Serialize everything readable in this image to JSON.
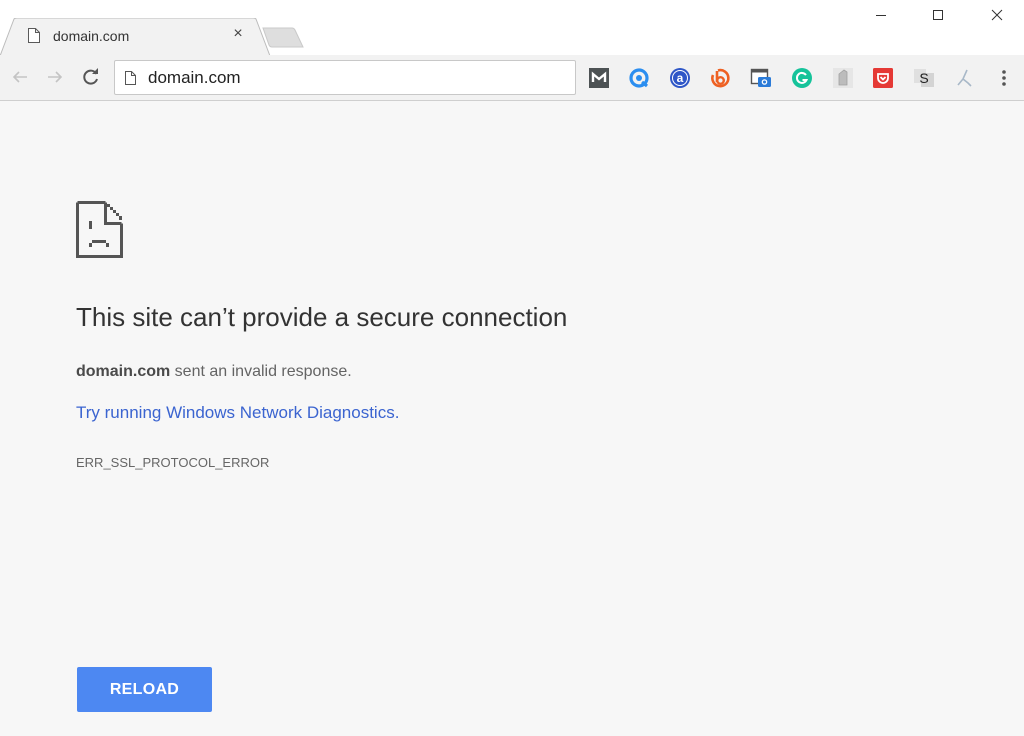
{
  "window": {
    "minimize_icon": "minimize-icon",
    "maximize_icon": "maximize-icon",
    "close_icon": "close-icon"
  },
  "tabs": [
    {
      "title": "domain.com",
      "icon": "page-icon",
      "close_glyph": "×",
      "active": true
    }
  ],
  "toolbar": {
    "back_icon": "arrow-left-icon",
    "forward_icon": "arrow-right-icon",
    "reload_icon": "reload-icon",
    "address": {
      "value": "domain.com",
      "icon": "page-icon"
    },
    "extensions": [
      {
        "name": "mailtrack",
        "glyph": "M",
        "color": "#4d5254"
      },
      {
        "name": "qeep",
        "glyph": "Q",
        "color": "#2b8ef0"
      },
      {
        "name": "amazon-assistant",
        "glyph": "a",
        "color": "#2e56c7"
      },
      {
        "name": "bitly",
        "glyph": "b",
        "color": "#ee6123"
      },
      {
        "name": "screenshot",
        "glyph": "",
        "color": "#2b7bd8"
      },
      {
        "name": "grammarly",
        "glyph": "G",
        "color": "#15c39a"
      },
      {
        "name": "evernote-clipper",
        "glyph": "",
        "color": "#bdbdbd"
      },
      {
        "name": "pocket",
        "glyph": "",
        "color": "#e53935"
      },
      {
        "name": "sumo",
        "glyph": "S",
        "color": "#cfcfcf"
      },
      {
        "name": "branch",
        "glyph": "",
        "color": "#9fb1c4"
      }
    ],
    "menu_icon": "more-vert-icon"
  },
  "error_page": {
    "icon": "sad-page-icon",
    "heading": "This site can’t provide a secure connection",
    "domain": "domain.com",
    "description_rest": " sent an invalid response.",
    "diagnostics_link": "Try running Windows Network Diagnostics.",
    "error_code": "ERR_SSL_PROTOCOL_ERROR",
    "reload_label": "RELOAD"
  },
  "colors": {
    "link": "#3b64d0",
    "button": "#4d88f2"
  }
}
